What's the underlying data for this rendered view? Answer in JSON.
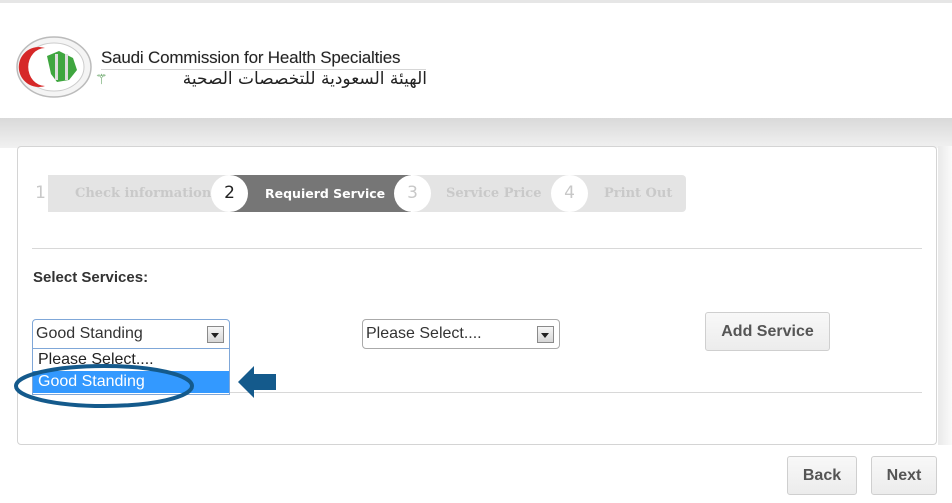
{
  "header": {
    "org_name_en": "Saudi Commission for Health Specialties",
    "org_name_ar": "الهيئة السعودية للتخصصات الصحية",
    "logo_icon": "schs-logo-icon",
    "palm_icon": "palm-swords-emblem-icon"
  },
  "wizard": {
    "steps": [
      {
        "number": "1",
        "label": "Check information",
        "state": "inactive"
      },
      {
        "number": "2",
        "label": "Requierd Service",
        "state": "active"
      },
      {
        "number": "3",
        "label": "Service Price",
        "state": "inactive"
      },
      {
        "number": "4",
        "label": "Print Out",
        "state": "inactive"
      }
    ],
    "active_color": "#767676",
    "inactive_color": "#e4e4e4"
  },
  "form": {
    "section_label": "Select Services:",
    "service_select": {
      "value": "Good Standing",
      "options": [
        "Please Select....",
        "Good Standing"
      ],
      "highlighted_option": "Good Standing",
      "open": true
    },
    "sub_service_select": {
      "value": "Please Select...."
    },
    "add_service_label": "Add Service"
  },
  "footer": {
    "back_label": "Back",
    "next_label": "Next"
  },
  "annotations": {
    "highlight_color": "#145a8c",
    "arrow_icon": "left-arrow-icon",
    "ellipse": "highlight-ellipse"
  },
  "colors": {
    "selected_option_bg": "#3399ff"
  }
}
